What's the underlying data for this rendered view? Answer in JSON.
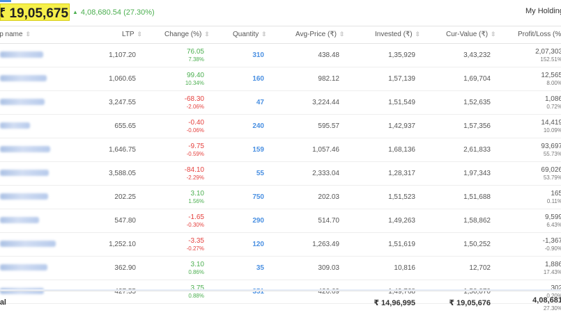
{
  "summary": {
    "total_value": "₹ 19,05,675.90",
    "gain_arrow": "▲",
    "gain_text": "4,08,680.54 (27.30%)",
    "my_holdings_label": "My Holdings"
  },
  "columns": {
    "name": "Scrip name",
    "ltp": "LTP",
    "change": "Change (%)",
    "quantity": "Quantity",
    "avg_price": "Avg-Price (₹)",
    "invested": "Invested (₹)",
    "cur_value": "Cur-Value (₹)",
    "pl": "Profit/Loss (%)"
  },
  "sort_glyph": "⇳",
  "rows": [
    {
      "ltp": "1,107.20",
      "change": "76.05",
      "change_pct": "7.38%",
      "dir": "pos",
      "qty": "310",
      "avg": "438.48",
      "invested": "1,35,929",
      "cur": "3,43,232",
      "pl": "2,07,303",
      "pl_pct": "152.51%",
      "name_w": 0.54
    },
    {
      "ltp": "1,060.65",
      "change": "99.40",
      "change_pct": "10.34%",
      "dir": "pos",
      "qty": "160",
      "avg": "982.12",
      "invested": "1,57,139",
      "cur": "1,69,704",
      "pl": "12,565",
      "pl_pct": "8.00%",
      "name_w": 0.68
    },
    {
      "ltp": "3,247.55",
      "change": "-68.30",
      "change_pct": "-2.06%",
      "dir": "neg",
      "qty": "47",
      "avg": "3,224.44",
      "invested": "1,51,549",
      "cur": "1,52,635",
      "pl": "1,086",
      "pl_pct": "0.72%",
      "name_w": 0.6
    },
    {
      "ltp": "655.65",
      "change": "-0.40",
      "change_pct": "-0.06%",
      "dir": "neg",
      "qty": "240",
      "avg": "595.57",
      "invested": "1,42,937",
      "cur": "1,57,356",
      "pl": "14,419",
      "pl_pct": "10.09%",
      "name_w": 0.08
    },
    {
      "ltp": "1,646.75",
      "change": "-9.75",
      "change_pct": "-0.59%",
      "dir": "neg",
      "qty": "159",
      "avg": "1,057.46",
      "invested": "1,68,136",
      "cur": "2,61,833",
      "pl": "93,697",
      "pl_pct": "55.73%",
      "name_w": 0.8
    },
    {
      "ltp": "3,588.05",
      "change": "-84.10",
      "change_pct": "-2.29%",
      "dir": "neg",
      "qty": "55",
      "avg": "2,333.04",
      "invested": "1,28,317",
      "cur": "1,97,343",
      "pl": "69,026",
      "pl_pct": "53.79%",
      "name_w": 0.74
    },
    {
      "ltp": "202.25",
      "change": "3.10",
      "change_pct": "1.56%",
      "dir": "pos",
      "qty": "750",
      "avg": "202.03",
      "invested": "1,51,523",
      "cur": "1,51,688",
      "pl": "165",
      "pl_pct": "0.11%",
      "name_w": 0.72
    },
    {
      "ltp": "547.80",
      "change": "-1.65",
      "change_pct": "-0.30%",
      "dir": "neg",
      "qty": "290",
      "avg": "514.70",
      "invested": "1,49,263",
      "cur": "1,58,862",
      "pl": "9,599",
      "pl_pct": "6.43%",
      "name_w": 0.4
    },
    {
      "ltp": "1,252.10",
      "change": "-3.35",
      "change_pct": "-0.27%",
      "dir": "neg",
      "qty": "120",
      "avg": "1,263.49",
      "invested": "1,51,619",
      "cur": "1,50,252",
      "pl": "-1,367",
      "pl_pct": "-0.90%",
      "name_w": 1.0
    },
    {
      "ltp": "362.90",
      "change": "3.10",
      "change_pct": "0.86%",
      "dir": "pos",
      "qty": "35",
      "avg": "309.03",
      "invested": "10,816",
      "cur": "12,702",
      "pl": "1,886",
      "pl_pct": "17.43%",
      "name_w": 0.7
    },
    {
      "ltp": "427.55",
      "change": "3.75",
      "change_pct": "0.88%",
      "dir": "pos",
      "qty": "351",
      "avg": "426.69",
      "invested": "1,49,768",
      "cur": "1,50,070",
      "pl": "302",
      "pl_pct": "0.20%",
      "name_w": 0.58
    }
  ],
  "footer": {
    "label": "Total",
    "invested": "₹ 14,96,995",
    "cur_value": "₹ 19,05,676",
    "pl": "4,08,681",
    "pl_pct": "27.30%"
  },
  "colors": {
    "positive": "#4caf50",
    "negative": "#e5413e",
    "quantity": "#4a90e2",
    "highlight": "#f6f04a"
  }
}
